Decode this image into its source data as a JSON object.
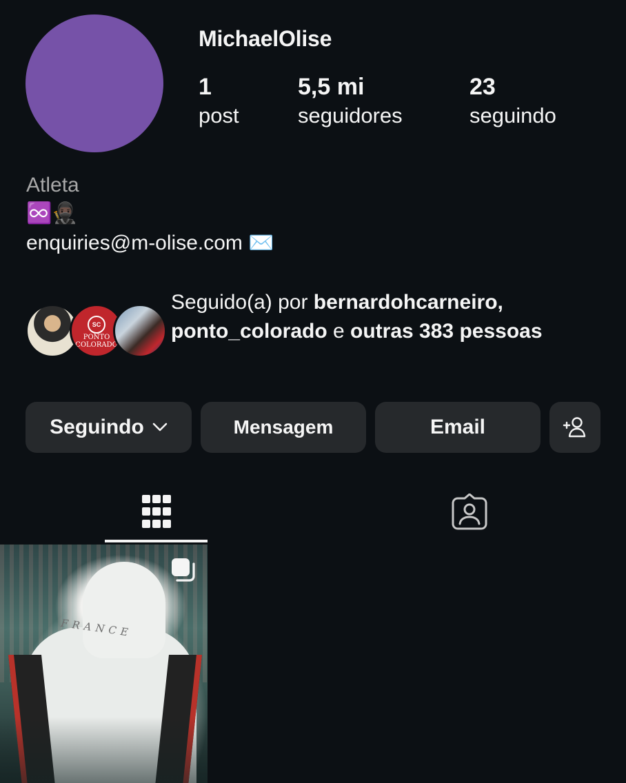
{
  "profile": {
    "username": "MichaelOlise",
    "avatar_color": "#7652a8",
    "stats": {
      "posts_count": "1",
      "posts_label": "post",
      "followers_count": "5,5 mi",
      "followers_label": "seguidores",
      "following_count": "23",
      "following_label": "seguindo"
    }
  },
  "bio": {
    "category": "Atleta",
    "emoji_line": "♾️🥷🏿",
    "email_line": "enquiries@m-olise.com ✉️"
  },
  "followed_by": {
    "prefix": "Seguido(a) por ",
    "user1": "bernardohcarneiro",
    "separator": ",",
    "user2": "ponto_colorado",
    "conjunction": " e ",
    "others": "outras 383",
    "suffix": "pessoas",
    "avatar2_text": "PONTO COLORADO"
  },
  "actions": {
    "following_label": "Seguindo",
    "message_label": "Mensagem",
    "email_label": "Email"
  },
  "tabs": {
    "active": "grid",
    "items": [
      "grid-icon",
      "tagged-icon"
    ]
  },
  "posts": [
    {
      "print_text": "FRANCE",
      "is_multi": true
    }
  ],
  "colors": {
    "background": "#0c1014",
    "button": "#26292c",
    "text": "#f5f5f5",
    "muted": "#a8a8a8"
  }
}
